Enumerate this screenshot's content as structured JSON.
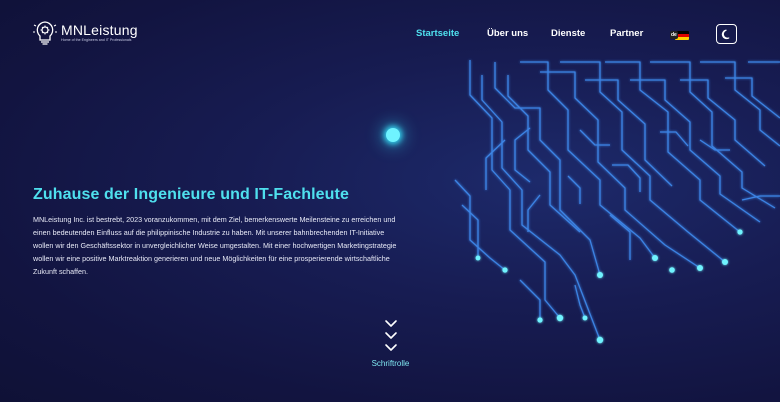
{
  "brand": {
    "name": "MNLeistung",
    "tagline": "Home of the Engineers and IT Professionals",
    "logo_icon": "lightbulb-gear-icon"
  },
  "nav": {
    "items": [
      {
        "label": "Startseite",
        "active": true
      },
      {
        "label": "Über uns",
        "active": false
      },
      {
        "label": "Dienste",
        "active": false
      },
      {
        "label": "Partner",
        "active": false
      }
    ],
    "language": {
      "code": "de",
      "flag": "germany-flag-icon"
    },
    "theme_toggle_icon": "moon-icon"
  },
  "hero": {
    "title": "Zuhause der Ingenieure und IT-Fachleute",
    "body": "MNLeistung Inc. ist bestrebt, 2023 voranzukommen, mit dem Ziel, bemerkenswerte Meilensteine zu erreichen und einen bedeutenden Einfluss auf die philippinische Industrie zu haben. Mit unserer bahnbrechenden IT-Initiative wollen wir den Geschäftssektor in unvergleichlicher Weise umgestalten. Mit einer hochwertigen Marketingstrategie wollen wir eine positive Marktreaktion generieren und neue Möglichkeiten für eine prosperierende wirtschaftliche Zukunft schaffen."
  },
  "scroll": {
    "label": "Schriftrolle",
    "icon": "chevron-down-icon"
  },
  "colors": {
    "background": "#14163f",
    "accent": "#4fe0ee",
    "circuit_line": "#3f8cf0",
    "circuit_glow": "#6ff3ff"
  }
}
